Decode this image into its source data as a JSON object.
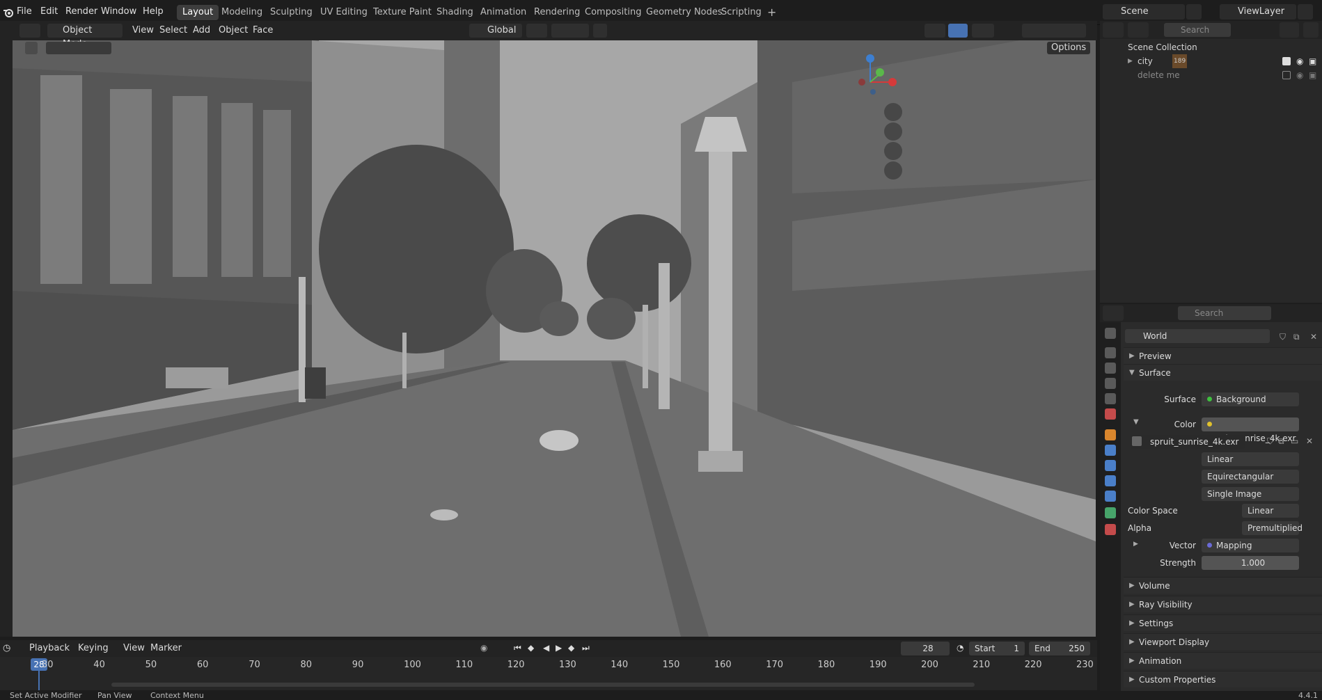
{
  "menu": {
    "file": "File",
    "edit": "Edit",
    "render": "Render",
    "window": "Window",
    "help": "Help"
  },
  "workspaces": [
    "Layout",
    "Modeling",
    "Sculpting",
    "UV Editing",
    "Texture Paint",
    "Shading",
    "Animation",
    "Rendering",
    "Compositing",
    "Geometry Nodes",
    "Scripting"
  ],
  "scene": {
    "name": "Scene",
    "view_layer": "ViewLayer"
  },
  "viewport_header": {
    "mode": "Object Mode",
    "menus": [
      "View",
      "Select",
      "Add",
      "Object",
      "Face"
    ],
    "transform_orientation": "Global",
    "options": "Options"
  },
  "outliner": {
    "search_placeholder": "Search",
    "collection": "Scene Collection",
    "items": [
      {
        "name": "city",
        "badge": "189"
      },
      {
        "name": "delete me"
      }
    ]
  },
  "properties": {
    "search_placeholder": "Search",
    "world_name": "World",
    "panels": {
      "preview": "Preview",
      "surface": "Surface",
      "volume": "Volume",
      "ray_visibility": "Ray Visibility",
      "settings": "Settings",
      "viewport_display": "Viewport Display",
      "animation": "Animation",
      "custom_properties": "Custom Properties"
    },
    "surface": {
      "surface_label": "Surface",
      "surface_value": "Background",
      "color_label": "Color",
      "color_value": "spruit_sunrise_4k.exr",
      "image_name": "spruit_sunrise_4k.exr",
      "interpolation": "Linear",
      "projection": "Equirectangular",
      "source": "Single Image",
      "color_space_label": "Color Space",
      "color_space_value": "Linear Rec....",
      "alpha_label": "Alpha",
      "alpha_value": "Premultiplied",
      "vector_label": "Vector",
      "vector_value": "Mapping",
      "strength_label": "Strength",
      "strength_value": "1.000"
    }
  },
  "timeline": {
    "menus": [
      "Playback",
      "Keying",
      "View",
      "Marker"
    ],
    "current_frame": "28",
    "start_label": "Start",
    "start_value": "1",
    "end_label": "End",
    "end_value": "250",
    "ticks": [
      "30",
      "40",
      "50",
      "60",
      "70",
      "80",
      "90",
      "100",
      "110",
      "120",
      "130",
      "140",
      "150",
      "160",
      "170",
      "180",
      "190",
      "200",
      "210",
      "220",
      "230"
    ]
  },
  "status_bar": {
    "items": [
      "Set Active Modifier",
      "Pan View",
      "Context Menu"
    ],
    "version": "4.4.1"
  },
  "colors": {
    "accent": "#4772b3",
    "background_dot": "#3fbf3f",
    "image_dot": "#e0c12d",
    "vector_dot": "#6b6bd6"
  }
}
